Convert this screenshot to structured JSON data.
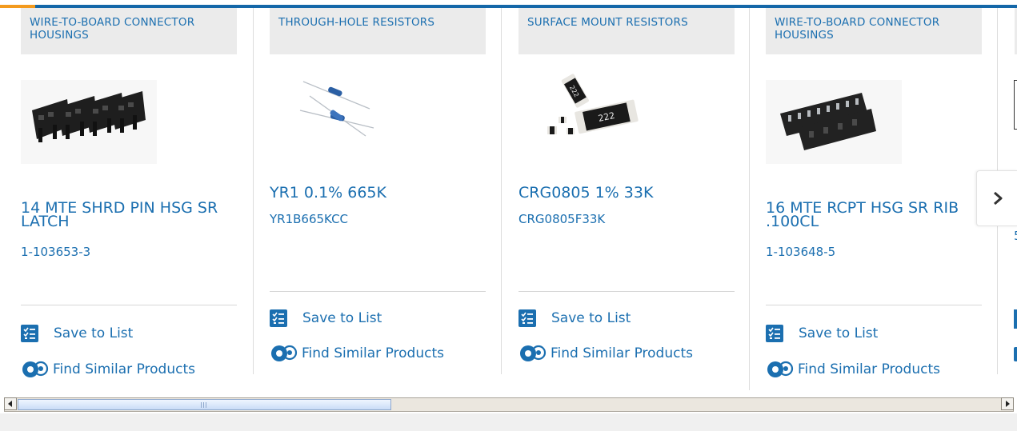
{
  "carousel": {
    "progress_fraction": 0.035,
    "next_button_icon": "chevron-right-icon",
    "cards": [
      {
        "category": "WIRE-TO-BOARD CONNECTOR HOUSINGS",
        "title": "14 MTE SHRD PIN HSG SR LATCH",
        "part_number": "1-103653-3",
        "save_label": "Save to List",
        "similar_label": "Find Similar Products",
        "image": "black-connector-housing-photo"
      },
      {
        "category": "THROUGH-HOLE RESISTORS",
        "title": "YR1 0.1% 665K",
        "part_number": "YR1B665KCC",
        "save_label": "Save to List",
        "similar_label": "Find Similar Products",
        "image": "axial-resistors-photo"
      },
      {
        "category": "SURFACE MOUNT RESISTORS",
        "title": "CRG0805 1% 33K",
        "part_number": "CRG0805F33K",
        "save_label": "Save to List",
        "similar_label": "Find Similar Products",
        "image": "smd-resistors-photo",
        "chip_marking_large": "222",
        "chip_marking_small": "222"
      },
      {
        "category": "WIRE-TO-BOARD CONNECTOR HOUSINGS",
        "title": "16 MTE RCPT HSG SR RIB .100CL",
        "part_number": "1-103648-5",
        "save_label": "Save to List",
        "similar_label": "Find Similar Products",
        "image": "receptacle-housing-photo"
      }
    ],
    "partial_card_part_fragment": "5"
  },
  "scrollbar": {
    "thumb_fraction": 0.38
  },
  "colors": {
    "brand_blue": "#1b6fb0",
    "accent_orange": "#f39a1e",
    "bar_blue": "#1467a8"
  }
}
